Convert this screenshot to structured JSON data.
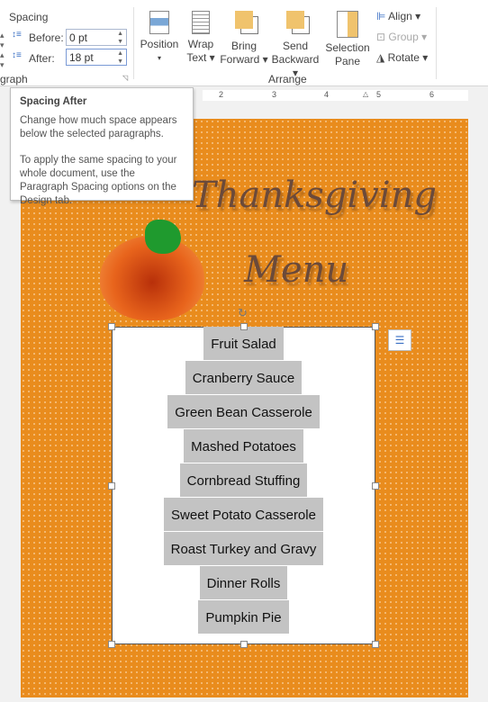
{
  "ribbon": {
    "spacing_title": "Spacing",
    "before_label": "Before:",
    "before_value": "0 pt",
    "after_label": "After:",
    "after_value": "18 pt",
    "paragraph_group": "graph",
    "position": "Position",
    "wrap_text_1": "Wrap",
    "wrap_text_2": "Text",
    "bring_1": "Bring",
    "bring_2": "Forward",
    "send_1": "Send",
    "send_2": "Backward",
    "sel_1": "Selection",
    "sel_2": "Pane",
    "align": "Align",
    "group": "Group",
    "rotate": "Rotate",
    "arrange_group": "Arrange"
  },
  "ruler": {
    "ticks": [
      "2",
      "3",
      "4",
      "5",
      "6"
    ]
  },
  "tooltip": {
    "title": "Spacing After",
    "line1": "Change how much space appears below the selected paragraphs.",
    "line2": "To apply the same spacing to your whole document, use the Paragraph Spacing options on the Design tab."
  },
  "document": {
    "title1": "Thanksgiving",
    "title2": "Menu",
    "menu": [
      "Fruit Salad",
      "Cranberry Sauce",
      "Green Bean Casserole",
      "Mashed Potatoes",
      "Cornbread Stuffing",
      "Sweet Potato Casserole",
      "Roast Turkey and Gravy",
      "Dinner Rolls",
      "Pumpkin Pie"
    ]
  },
  "colors": {
    "page": "#e98c1d",
    "highlight": "#c3c3c3",
    "title": "#6b4a3a"
  }
}
